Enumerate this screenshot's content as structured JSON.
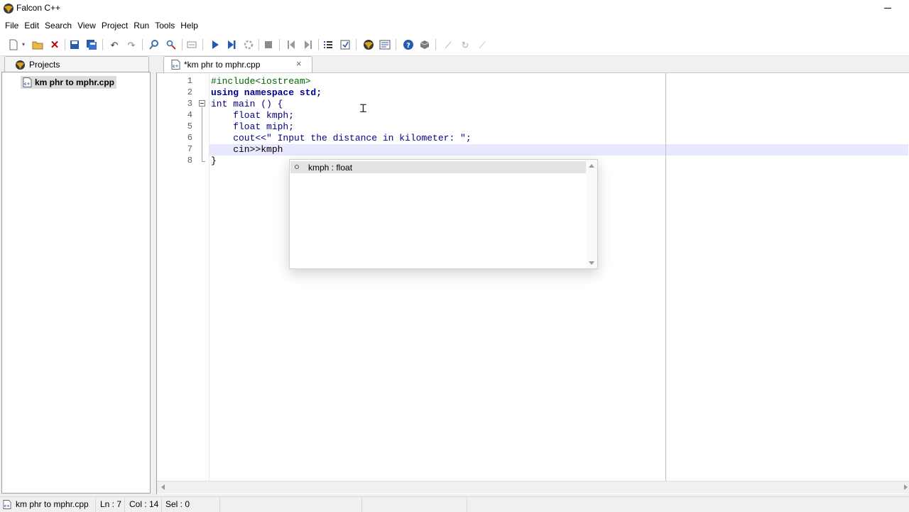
{
  "window": {
    "title": "Falcon C++"
  },
  "menu": [
    "File",
    "Edit",
    "Search",
    "View",
    "Project",
    "Run",
    "Tools",
    "Help"
  ],
  "left_panel": {
    "tab_label": "Projects",
    "tree_items": [
      "km phr to mphr.cpp"
    ]
  },
  "editor": {
    "tab_label": "*km phr to mphr.cpp",
    "line_numbers": [
      "1",
      "2",
      "3",
      "4",
      "5",
      "6",
      "7",
      "8"
    ],
    "lines": [
      "#include<iostream>",
      "using namespace std;",
      "int main () {",
      "    float kmph;",
      "    float miph;",
      "    cout<<\" Input the distance in kilometer: \";",
      "    cin>>kmph",
      "}"
    ],
    "current_line": 7
  },
  "autocomplete": {
    "items": [
      "kmph : float"
    ]
  },
  "status": {
    "file": "km phr to mphr.cpp",
    "line": "Ln : 7",
    "col": "Col : 14",
    "sel": "Sel : 0"
  },
  "colors": {
    "keyword": "#00008b",
    "current_line_bg": "#e8e8ff",
    "selection_bg": "#e3e3e3"
  },
  "icons": [
    "new-file-icon",
    "open-folder-icon",
    "close-icon",
    "save-icon",
    "save-all-icon",
    "undo-icon",
    "redo-icon",
    "find-icon",
    "replace-icon",
    "toggle-comment-icon",
    "run-icon",
    "step-icon",
    "build-icon",
    "stop-icon",
    "prev-icon",
    "next-icon",
    "list-icon",
    "goto-icon",
    "falcon-icon",
    "options-icon",
    "help-icon",
    "about-icon"
  ]
}
